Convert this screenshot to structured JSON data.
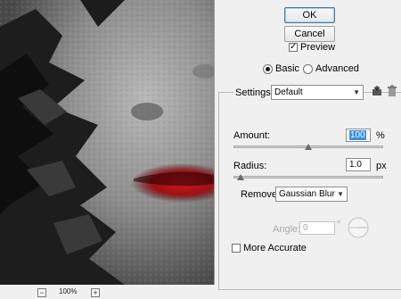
{
  "zoom": {
    "minus_label": "−",
    "plus_label": "+",
    "value": "100%"
  },
  "buttons": {
    "ok": "OK",
    "cancel": "Cancel"
  },
  "preview_toggle": {
    "label": "Preview",
    "checked": true
  },
  "mode": {
    "basic": "Basic",
    "advanced": "Advanced",
    "selected": "basic"
  },
  "settings": {
    "label": "Settings:",
    "value": "Default"
  },
  "amount": {
    "label": "Amount:",
    "value": "100",
    "unit": "%",
    "slider_fraction": 0.5
  },
  "radius": {
    "label": "Radius:",
    "value": "1.0",
    "unit": "px",
    "slider_fraction": 0.05
  },
  "remove": {
    "label": "Remove:",
    "value": "Gaussian Blur"
  },
  "angle": {
    "label": "Angle:",
    "value": "0",
    "unit": "°"
  },
  "more_accurate": {
    "label": "More Accurate",
    "checked": false
  },
  "icons": {
    "save": "save-preset-icon",
    "delete": "trash-icon"
  }
}
